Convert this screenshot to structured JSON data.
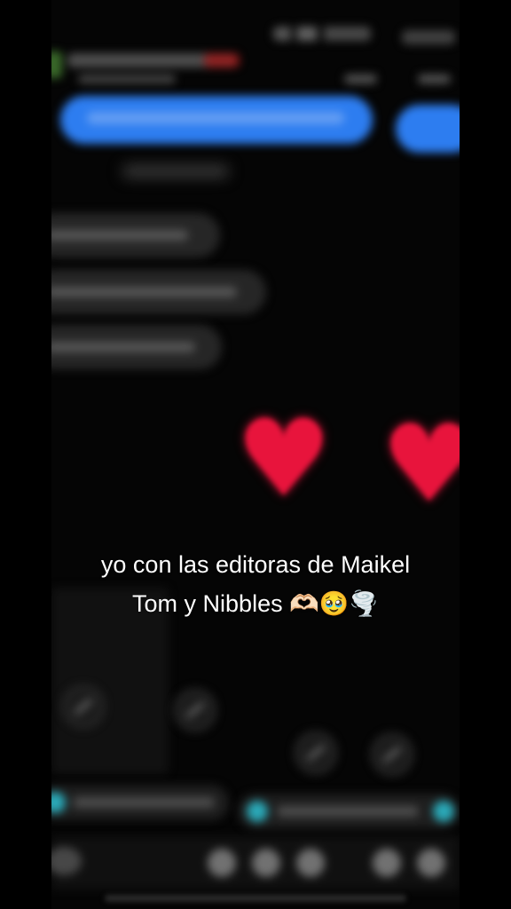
{
  "caption": {
    "line1": "yo con las editoras de Maikel",
    "line2": "Tom y Nibbles 🫶🏻🥹🌪️"
  },
  "background": {
    "description_icon_names": [
      "heart-icon",
      "heart-icon"
    ],
    "colors": {
      "page": "#000000",
      "blue_bubble": "#2d7df0",
      "gray_bubble": "#262626",
      "heart": "#e8143c",
      "accent_teal": "#2aa9b8",
      "caption_text": "#ffffff"
    }
  }
}
